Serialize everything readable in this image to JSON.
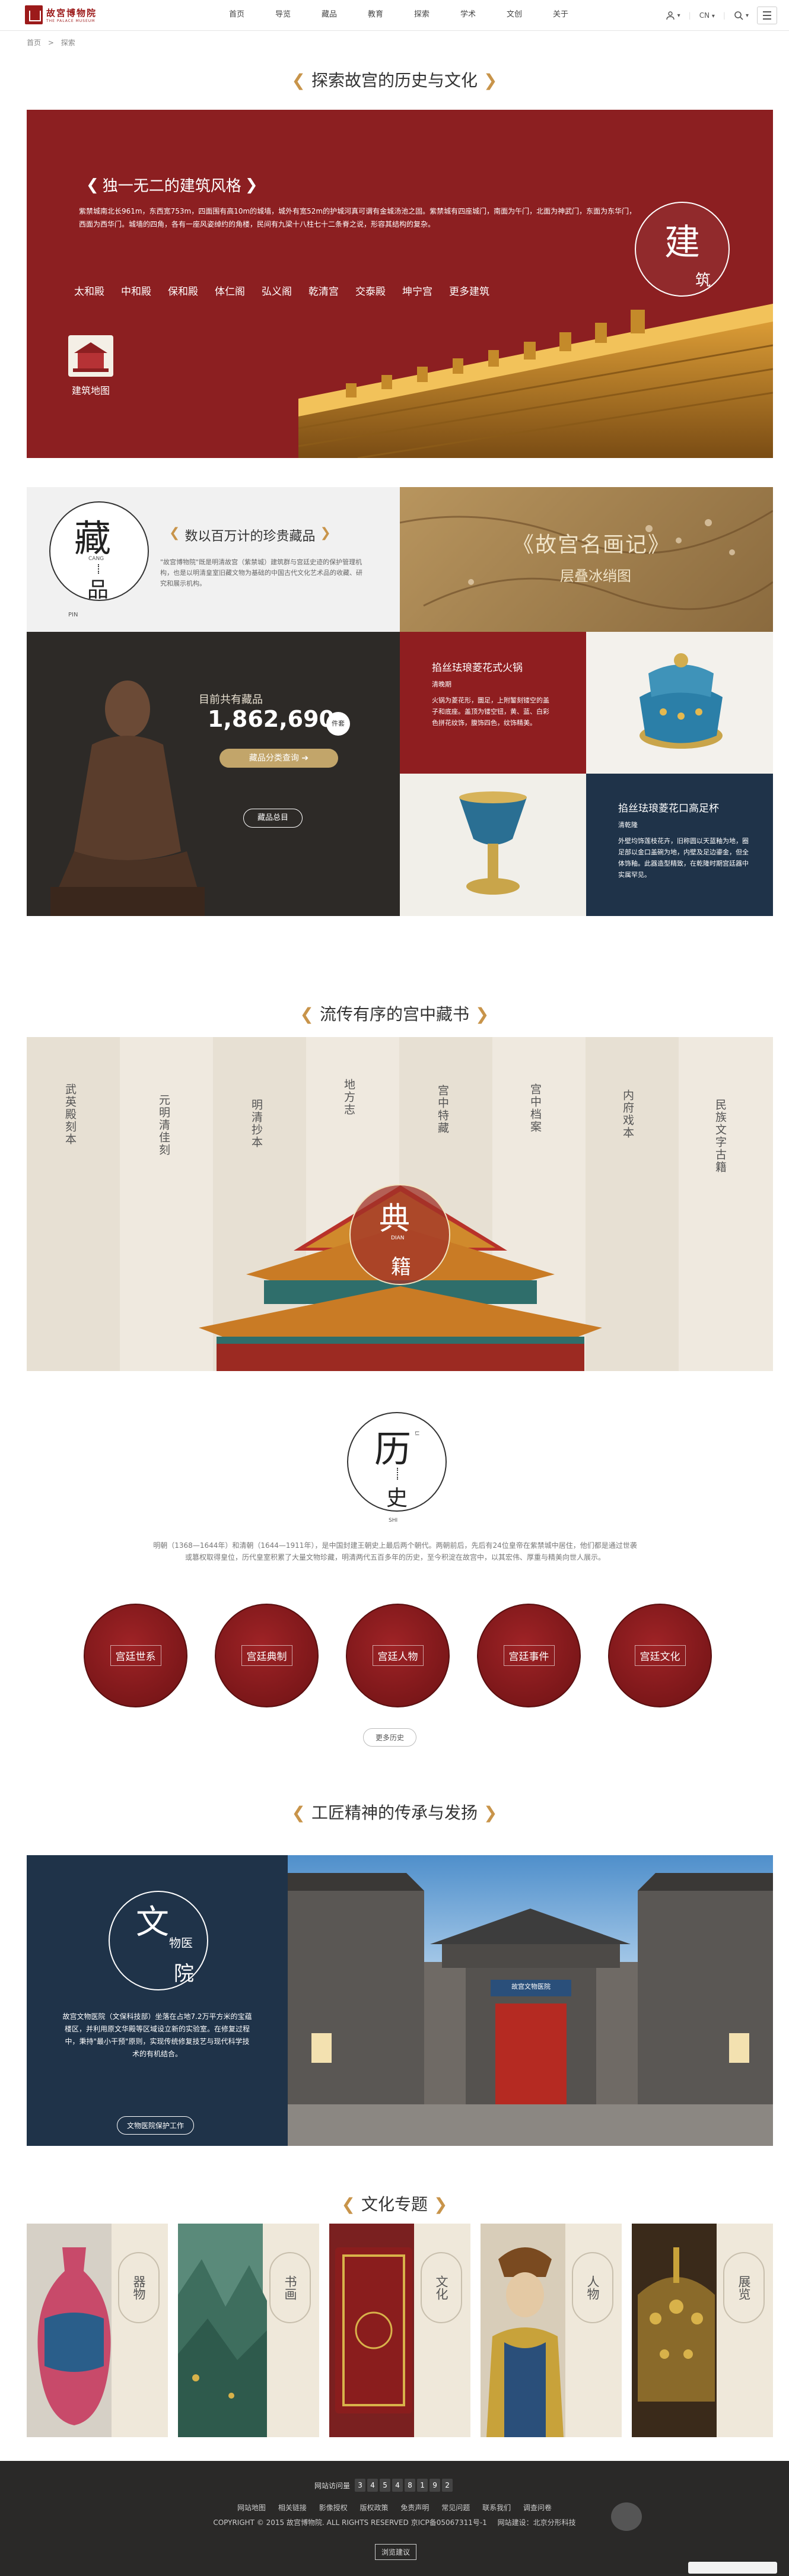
{
  "nav": {
    "logo_text": "故宮博物院",
    "logo_sub": "THE PALACE MUSEUM",
    "menu": [
      "首页",
      "导览",
      "藏品",
      "教育",
      "探索",
      "学术",
      "文创",
      "关于"
    ],
    "lang": "CN",
    "lang_arrow": "▾"
  },
  "breadcrumb": {
    "home": "首页",
    "sep": ">",
    "current": "探索"
  },
  "section1": {
    "title": "探索故宫的历史与文化",
    "heading": "独一无二的建筑风格",
    "desc": "紫禁城南北长961m，东西宽753m，四面围有高10m的城墙，城外有宽52m的护城河真可谓有金城汤池之固。紫禁城有四座城门，南面为午门，北面为神武门，东面为东华门，西面为西华门。城墙的四角，各有一座风姿绰约的角楼，民间有九梁十八柱七十二条脊之说，形容其结构的复杂。",
    "categories": [
      "太和殿",
      "中和殿",
      "保和殿",
      "体仁阁",
      "弘义阁",
      "乾清宫",
      "交泰殿",
      "坤宁宫",
      "更多建筑"
    ],
    "map_label": "建筑地图",
    "badge_top": "建",
    "badge_bottom": "筑"
  },
  "section2": {
    "badge_top": "藏",
    "badge_top_en": "CANG",
    "badge_bottom": "品",
    "badge_bottom_en": "PIN",
    "heading": "数以百万计的珍贵藏品",
    "desc": "\"故宫博物院\"既是明清故宫（紫禁城）建筑群与宫廷史迹的保护管理机构，也是以明清皇室旧藏文物为基础的中国古代文化艺术品的收藏、研究和展示机构。",
    "painting_title": "《故宫名画记》",
    "painting_sub": "层叠冰绡图",
    "count_label": "目前共有藏品",
    "count": "1,862,690",
    "count_unit": "件套",
    "search_btn": "藏品分类查询",
    "search_arrow": "➔",
    "overview_btn": "藏品总目",
    "item1_title": "掐丝珐琅菱花式火锅",
    "item1_sub": "清晚期",
    "item1_desc": "火锅为菱花形，圜足，上附錾刻镂空的盖子和底座。盖顶为镂空钮，黄、蓝、白彩色拼花纹饰，腹饰四色，纹饰精美。",
    "item2_title": "掐丝珐琅菱花口高足杯",
    "item2_sub": "清乾隆",
    "item2_desc": "外壁均饰莲枝花卉，旧称圆以天蓝釉为地，圈足部以金口盖碗为地，内壁及足边鎏金，但全体饰釉。此器造型精致，在乾隆时期宫廷器中实属罕见。",
    "colors": {
      "red": "#8c1f21",
      "navy": "#1f3349",
      "gold": "#c8944a"
    }
  },
  "section3": {
    "title": "流传有序的宫中藏书",
    "columns": [
      "武英殿刻本",
      "元明清佳刻",
      "明清抄本",
      "地方志",
      "宫中特藏",
      "宫中档案",
      "内府戏本",
      "民族文字古籍"
    ],
    "badge_top": "典",
    "badge_en_top": "DIAN",
    "badge_bottom": "籍",
    "badge_en_bottom": "JI"
  },
  "section4": {
    "badge_top": "历",
    "badge_en_top": "LI",
    "badge_bottom": "史",
    "badge_en_bottom": "SHI",
    "desc": "明朝（1368—1644年）和清朝（1644—1911年），是中国封建王朝史上最后两个朝代。两朝前后，先后有24位皇帝在紫禁城中居住，他们都是通过世袭或篡权取得皇位，历代皇室积累了大量文物珍藏，明清两代五百多年的历史，至今积淀在故宫中，以其宏伟、厚重与精美向世人展示。",
    "circles": [
      "宫廷世系",
      "宫廷典制",
      "宫廷人物",
      "宫廷事件",
      "宫廷文化"
    ],
    "more_btn": "更多历史"
  },
  "section5": {
    "title": "工匠精神的传承与发扬",
    "badge_top": "文",
    "badge_mid": "物医",
    "badge_bottom": "院",
    "desc": "故宫文物医院（文保科技部）坐落在占地7.2万平方米的宝蕴楼区，并利用原文华殿等区域设立新的实验室。在修复过程中，秉持\"最小干预\"原则，实现传统修复技艺与现代科学技术的有机结合。",
    "btn": "文物医院保护工作",
    "gate_sign": "故宫文物医院"
  },
  "section6": {
    "title": "文化专题",
    "topics": [
      "器物",
      "书画",
      "文化",
      "人物",
      "展览"
    ]
  },
  "footer": {
    "visits_label": "网站访问量",
    "visits": [
      "3",
      "4",
      "5",
      "4",
      "8",
      "1",
      "9",
      "2"
    ],
    "links": [
      "网站地图",
      "相关链接",
      "影像授权",
      "版权政策",
      "免责声明",
      "常见问题",
      "联系我们",
      "调查问卷"
    ],
    "copyright": "COPYRIGHT © 2015 故宫博物院. ALL RIGHTS RESERVED  京ICP备05067311号-1",
    "build": "网站建设：北京分形科技",
    "suggest": "浏览建议"
  }
}
